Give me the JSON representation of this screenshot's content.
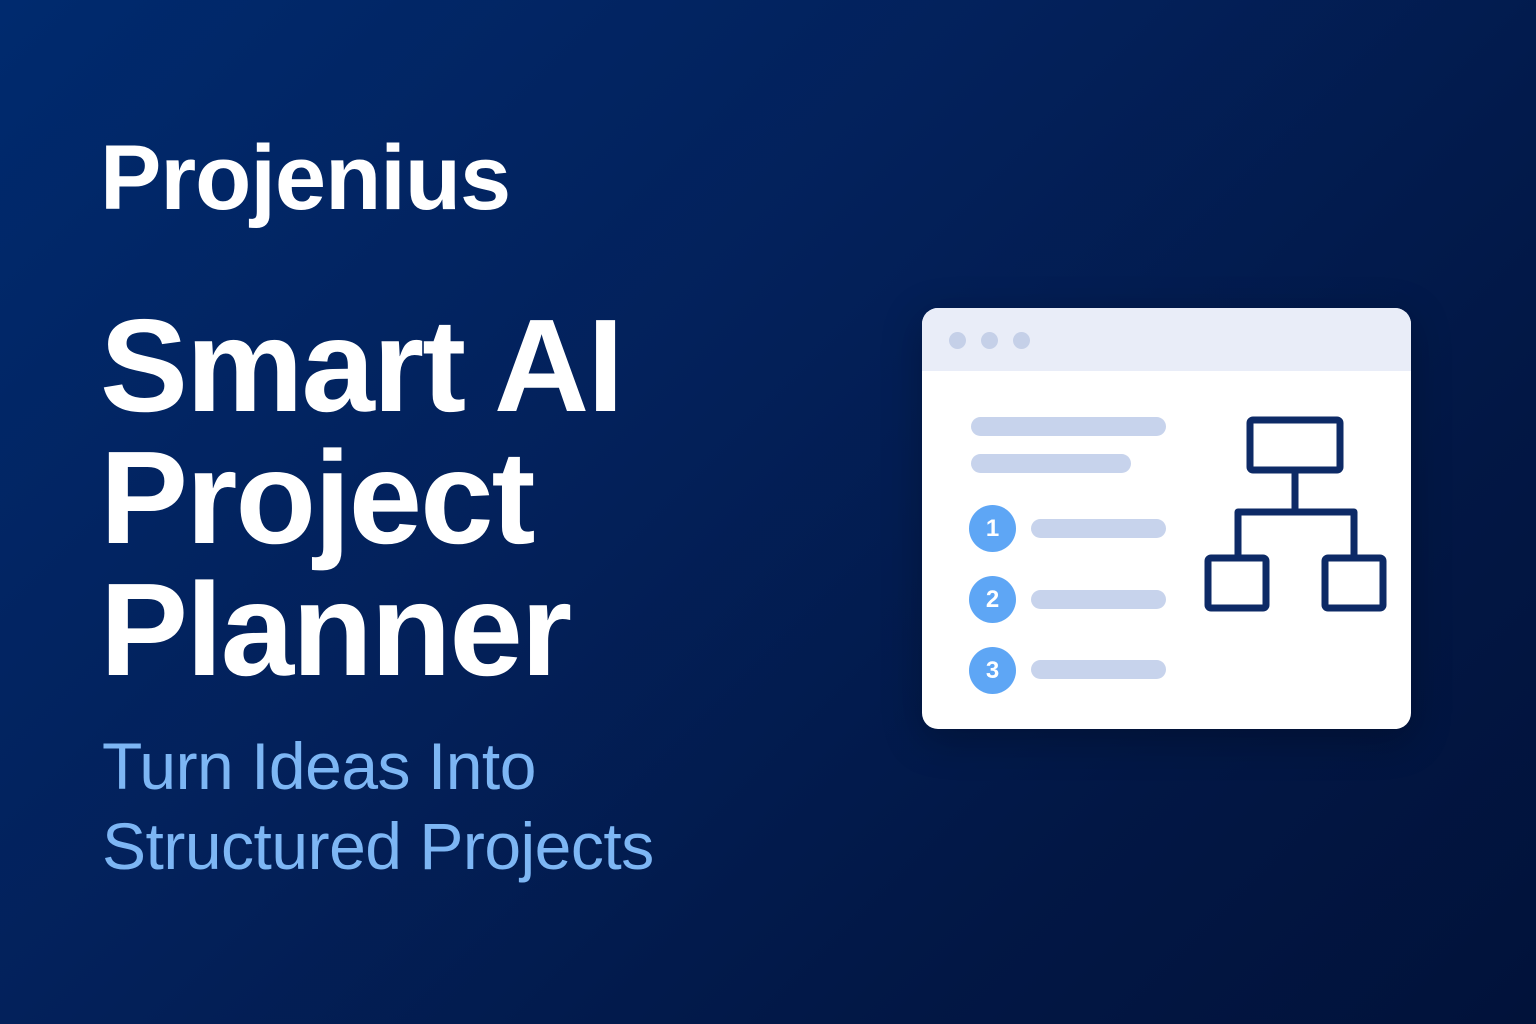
{
  "brand": {
    "name": "Projenius"
  },
  "headline": {
    "lines": [
      "Smart AI",
      "Project",
      "Planner"
    ]
  },
  "tagline": {
    "lines": [
      "Turn Ideas Into",
      "Structured Projects"
    ]
  },
  "illustration": {
    "steps": [
      "1",
      "2",
      "3"
    ],
    "icon": "hierarchy-icon"
  },
  "colors": {
    "background": "#02225f",
    "accent": "#7db6f4",
    "step_badge": "#5ea6f5",
    "hierarchy_stroke": "#0d2a66"
  }
}
